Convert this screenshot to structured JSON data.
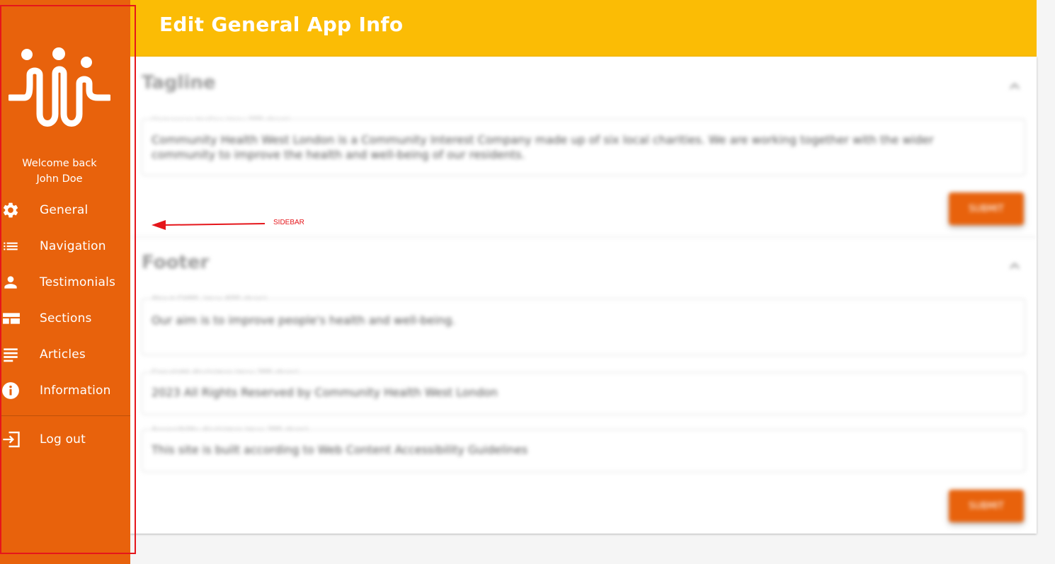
{
  "header": {
    "title": "Edit General App Info"
  },
  "sidebar": {
    "welcome_line1": "Welcome back",
    "welcome_line2": "John Doe",
    "items": [
      {
        "label": "General",
        "icon": "gear-icon"
      },
      {
        "label": "Navigation",
        "icon": "list-icon"
      },
      {
        "label": "Testimonials",
        "icon": "person-icon"
      },
      {
        "label": "Sections",
        "icon": "layout-icon"
      },
      {
        "label": "Articles",
        "icon": "article-icon"
      },
      {
        "label": "Information",
        "icon": "info-icon"
      }
    ],
    "logout_label": "Log out",
    "background_color": "#e8620c"
  },
  "annotation": {
    "label": "SIDEBAR",
    "color": "#e5161b"
  },
  "tagline": {
    "title": "Tagline",
    "field_label": "Homepage tagline (max 200 chars)",
    "value": "Community Health West London is a Community Interest Company made up of six local charities. We are working together with the wider community to improve the health and well-being of our residents."
  },
  "footer": {
    "title": "Footer",
    "fields": [
      {
        "label": "About CHWL (max 600 chars)",
        "value": "Our aim is to improve people's health and well-being."
      },
      {
        "label": "Copyright disclaimer (max 200 chars)",
        "value": "2023 All Rights Reserved by Community Health West London"
      },
      {
        "label": "Accessibility disclaimer (max 200 chars)",
        "value": "This site is built according to Web Content Accessibility Guidelines"
      }
    ]
  },
  "submit_label": "SUBMIT",
  "colors": {
    "accent": "#e8620c",
    "header": "#fbbc05"
  }
}
